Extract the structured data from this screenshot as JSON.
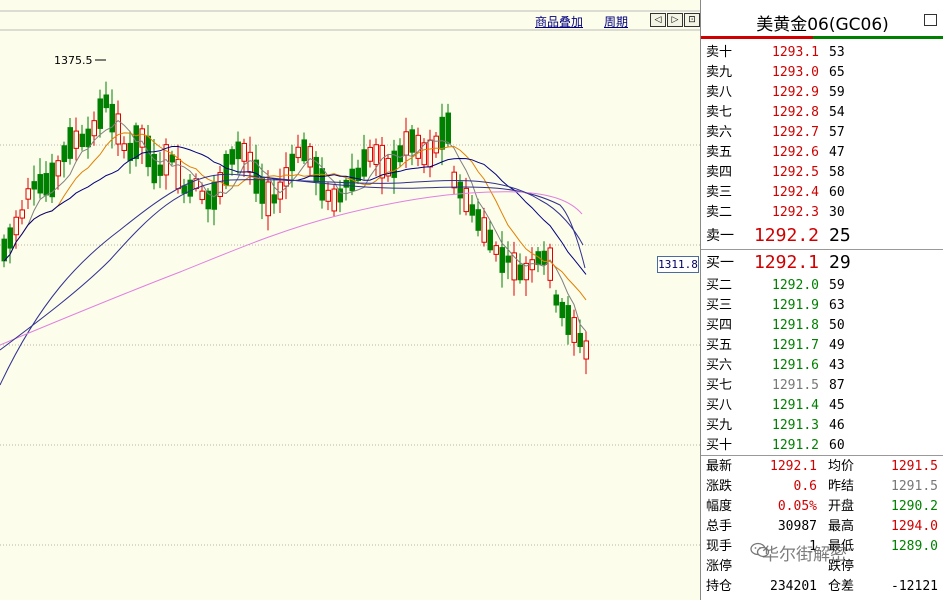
{
  "toolbar": {
    "overlay_label": "商品叠加",
    "period_label": "周期",
    "nav_left": "◁",
    "nav_right": "▷",
    "nav_expand": "⊡"
  },
  "chart": {
    "high_annotation": "1375.5",
    "price_tag": "1311.8",
    "colors": {
      "background": "#fdfdeb",
      "up_candle": "#e00000",
      "down_candle": "#008000",
      "ma_short": "#808080",
      "ma_mid": "#e08000",
      "ma_long": "#000080",
      "ma_longer": "#303090",
      "ma_longest": "#e080e0"
    }
  },
  "panel": {
    "title": "美黄金06(GC06)",
    "asks": [
      {
        "label": "卖十",
        "price": "1293.1",
        "vol": "53"
      },
      {
        "label": "卖九",
        "price": "1293.0",
        "vol": "65"
      },
      {
        "label": "卖八",
        "price": "1292.9",
        "vol": "59"
      },
      {
        "label": "卖七",
        "price": "1292.8",
        "vol": "54"
      },
      {
        "label": "卖六",
        "price": "1292.7",
        "vol": "57"
      },
      {
        "label": "卖五",
        "price": "1292.6",
        "vol": "47"
      },
      {
        "label": "卖四",
        "price": "1292.5",
        "vol": "58"
      },
      {
        "label": "卖三",
        "price": "1292.4",
        "vol": "60"
      },
      {
        "label": "卖二",
        "price": "1292.3",
        "vol": "30"
      },
      {
        "label": "卖一",
        "price": "1292.2",
        "vol": "25"
      }
    ],
    "bids": [
      {
        "label": "买一",
        "price": "1292.1",
        "vol": "29"
      },
      {
        "label": "买二",
        "price": "1292.0",
        "vol": "59"
      },
      {
        "label": "买三",
        "price": "1291.9",
        "vol": "63"
      },
      {
        "label": "买四",
        "price": "1291.8",
        "vol": "50"
      },
      {
        "label": "买五",
        "price": "1291.7",
        "vol": "49"
      },
      {
        "label": "买六",
        "price": "1291.6",
        "vol": "43"
      },
      {
        "label": "买七",
        "price": "1291.5",
        "vol": "87"
      },
      {
        "label": "买八",
        "price": "1291.4",
        "vol": "45"
      },
      {
        "label": "买九",
        "price": "1291.3",
        "vol": "46"
      },
      {
        "label": "买十",
        "price": "1291.2",
        "vol": "60"
      }
    ],
    "stats_left": [
      {
        "label": "最新",
        "value": "1292.1"
      },
      {
        "label": "涨跌",
        "value": "0.6"
      },
      {
        "label": "幅度",
        "value": "0.05%"
      },
      {
        "label": "总手",
        "value": "30987"
      },
      {
        "label": "现手",
        "value": "1"
      },
      {
        "label": "涨停",
        "value": ""
      },
      {
        "label": "持仓",
        "value": "234201"
      }
    ],
    "stats_right": [
      {
        "label": "均价",
        "value": "1291.5"
      },
      {
        "label": "昨结",
        "value": "1291.5"
      },
      {
        "label": "开盘",
        "value": "1290.2"
      },
      {
        "label": "最高",
        "value": "1294.0"
      },
      {
        "label": "最低",
        "value": "1289.0"
      },
      {
        "label": "跌停",
        "value": ""
      },
      {
        "label": "仓差",
        "value": "-12121"
      }
    ],
    "watermark": "华尔街解密"
  }
}
